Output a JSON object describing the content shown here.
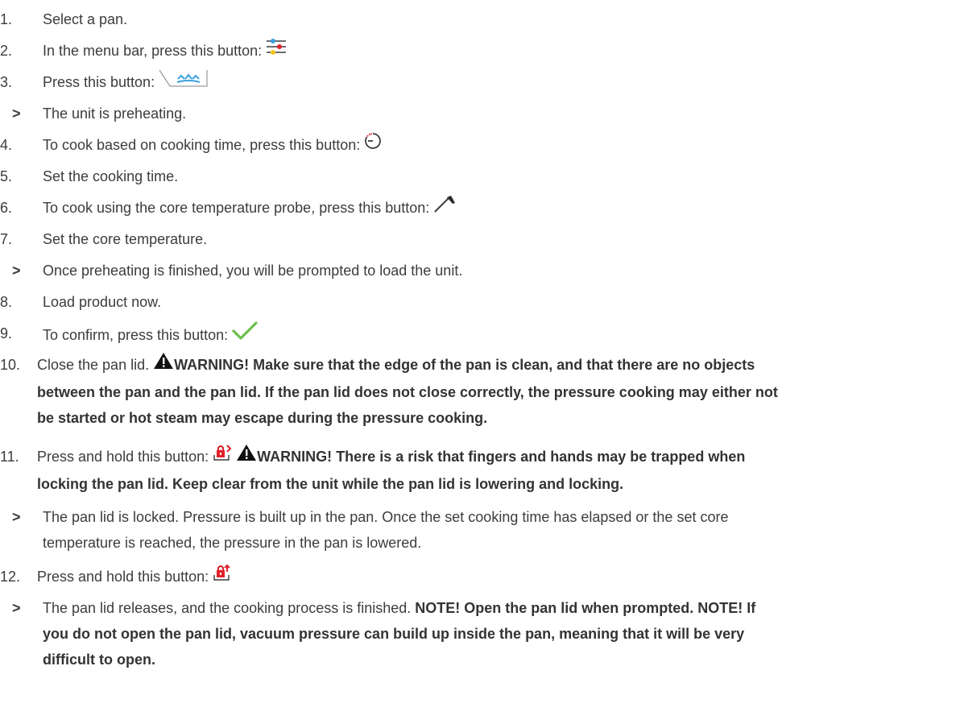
{
  "steps": [
    {
      "marker": "1.",
      "text": "Select a pan."
    },
    {
      "marker": "2.",
      "text": "In the menu bar, press this button:",
      "icon": "settings-sliders-icon"
    },
    {
      "marker": "3.",
      "text": "Press this button:",
      "icon": "preheat-tab-icon"
    },
    {
      "marker": ">",
      "text": "The unit is preheating."
    },
    {
      "marker": "4.",
      "text": "To cook based on cooking time, press this button:",
      "icon": "timer-icon"
    },
    {
      "marker": "5.",
      "text": "Set the cooking time."
    },
    {
      "marker": "6.",
      "text": "To cook using the core temperature probe, press this button:",
      "icon": "core-probe-icon"
    },
    {
      "marker": "7.",
      "text": "Set the core temperature."
    },
    {
      "marker": ">",
      "text": "Once preheating is finished, you will be prompted to load the unit."
    },
    {
      "marker": "8.",
      "text": "Load product now."
    },
    {
      "marker": "9.",
      "text": "To confirm, press this button:",
      "icon": "checkmark-icon"
    },
    {
      "marker": "10.",
      "text": "Close the pan lid.",
      "warning_label": "WARNING!",
      "warning_text_1": "Make sure that the edge of the pan is clean, and that there are no objects",
      "warning_text_2": "between the pan and the pan lid. If the pan lid does not close correctly, the pressure cooking may either not",
      "warning_text_3": "be started or hot steam may escape during the pressure cooking."
    },
    {
      "marker": "11.",
      "text": "Press and hold this button:",
      "icon": "lock-lid-icon",
      "warning_label": "WARNING!",
      "warning_text_1": "There is a risk that fingers and hands may be trapped when",
      "warning_text_2": "locking the pan lid. Keep clear from the unit while the pan lid is lowering and locking."
    },
    {
      "marker": ">",
      "text_1": "The pan lid is locked. Pressure is built up in the pan. Once the set cooking time has elapsed or the set core",
      "text_2": "temperature is reached, the pressure in the pan is lowered."
    },
    {
      "marker": "12.",
      "text": "Press and hold this button:",
      "icon": "unlock-lid-icon"
    },
    {
      "marker": ">",
      "text_1": "The pan lid releases, and the cooking process is finished.",
      "note_1": "NOTE! Open the pan lid when prompted. NOTE!  If",
      "note_2": "you do not open the pan lid, vacuum pressure can build up inside the pan, meaning that it will be very",
      "note_3": "difficult to open."
    }
  ],
  "colors": {
    "text": "#3c3c3c",
    "blue": "#3aa0e0",
    "red": "#e0202a",
    "yellow": "#f5c518",
    "green": "#6cc04a",
    "warning": "#111111"
  }
}
